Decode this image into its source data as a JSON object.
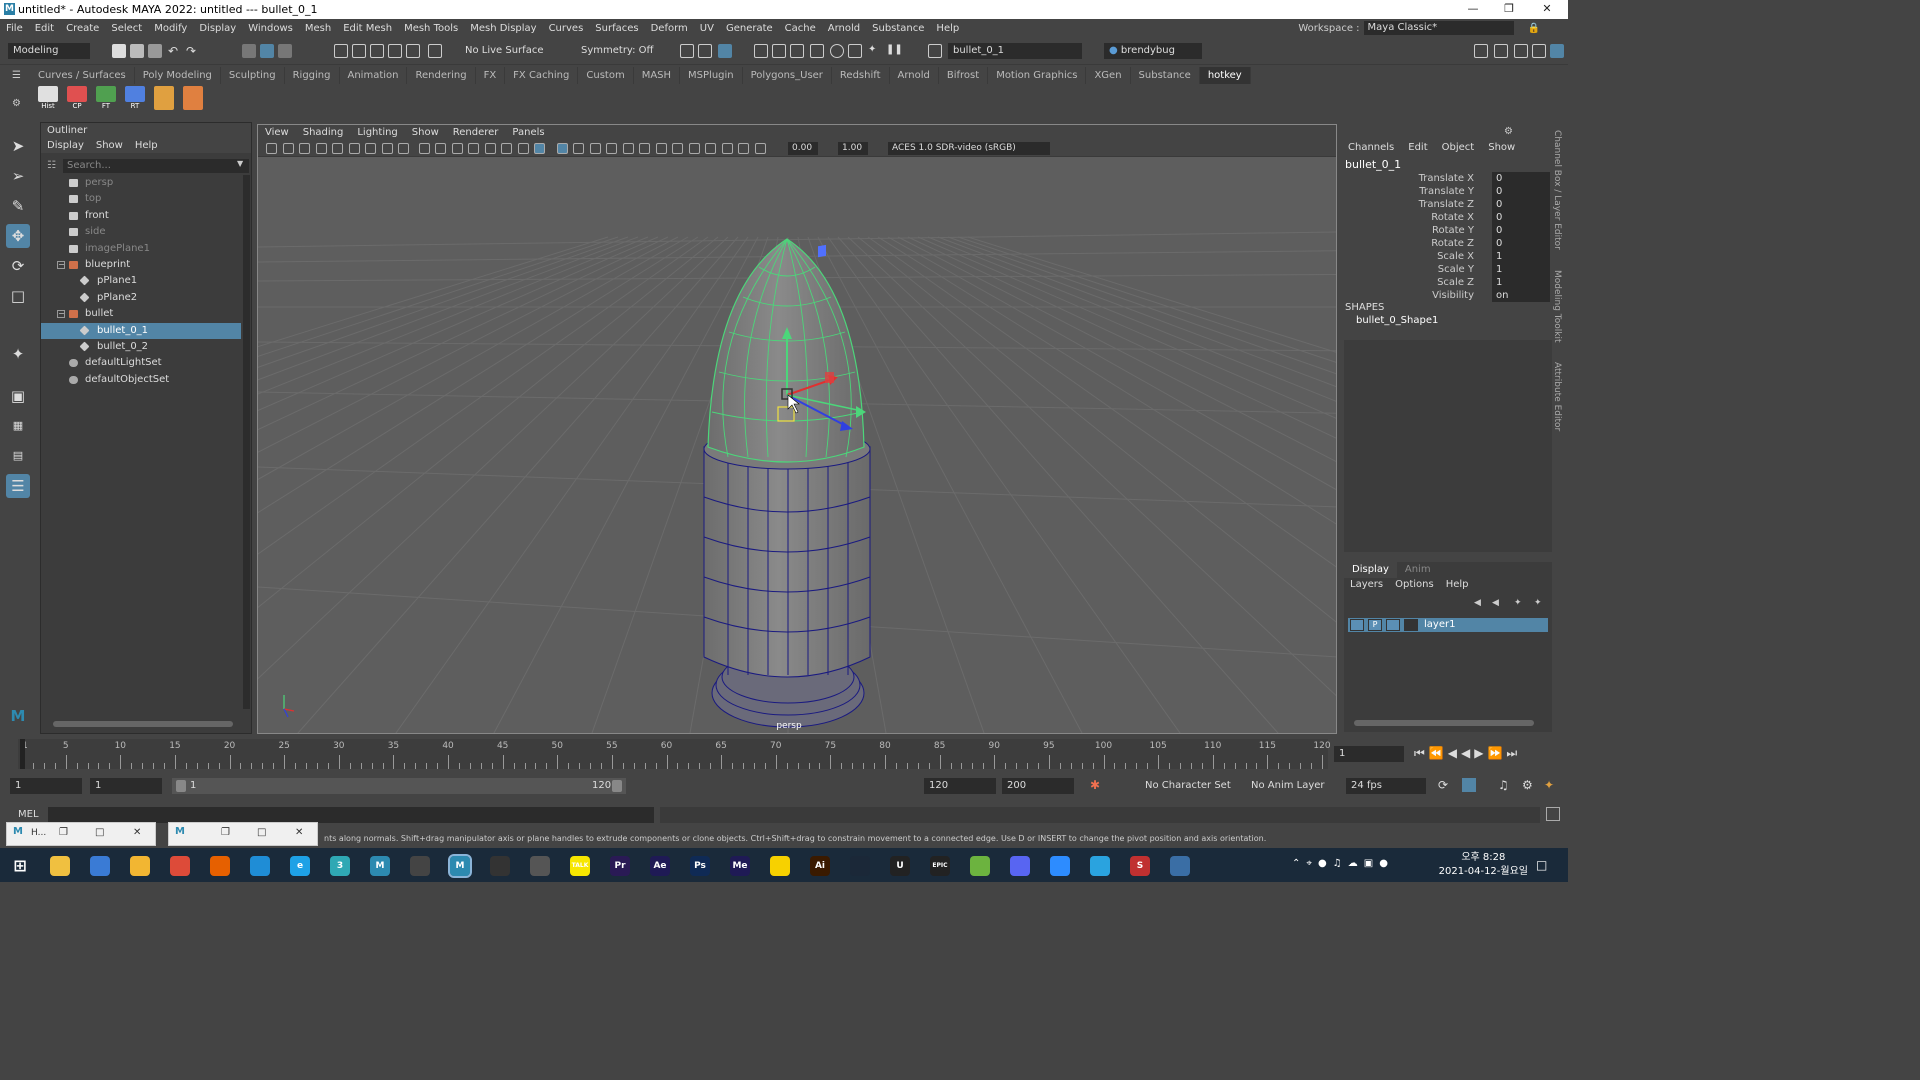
{
  "window": {
    "title": "untitled* - Autodesk MAYA 2022: untitled   ---   bullet_0_1",
    "logo": "M"
  },
  "menubar": [
    "File",
    "Edit",
    "Create",
    "Select",
    "Modify",
    "Display",
    "Windows",
    "Mesh",
    "Edit Mesh",
    "Mesh Tools",
    "Mesh Display",
    "Curves",
    "Surfaces",
    "Deform",
    "UV",
    "Generate",
    "Cache",
    "Arnold",
    "Substance",
    "Help"
  ],
  "workspace": {
    "label": "Workspace :",
    "value": "Maya Classic*"
  },
  "statusline": {
    "mode": "Modeling",
    "live_surface": "No Live Surface",
    "symmetry": "Symmetry: Off",
    "object_field": "bullet_0_1",
    "user": "brendybug"
  },
  "shelf_tabs": [
    "Curves / Surfaces",
    "Poly Modeling",
    "Sculpting",
    "Rigging",
    "Animation",
    "Rendering",
    "FX",
    "FX Caching",
    "Custom",
    "MASH",
    "MSPlugin",
    "Polygons_User",
    "Redshift",
    "Arnold",
    "Bifrost",
    "Motion Graphics",
    "XGen",
    "Substance",
    "hotkey"
  ],
  "shelf_active": "hotkey",
  "shelf_buttons": [
    {
      "label": "Hist",
      "color": "#e0e0e0"
    },
    {
      "label": "CP",
      "color": "#e05050"
    },
    {
      "label": "FT",
      "color": "#50a050"
    },
    {
      "label": "RT",
      "color": "#5080e0"
    }
  ],
  "outliner": {
    "title": "Outliner",
    "menu": [
      "Display",
      "Show",
      "Help"
    ],
    "search_placeholder": "Search...",
    "items": [
      {
        "label": "persp",
        "dim": true
      },
      {
        "label": "top",
        "dim": true
      },
      {
        "label": "front",
        "dim": false
      },
      {
        "label": "side",
        "dim": true
      },
      {
        "label": "imagePlane1",
        "dim": true
      },
      {
        "label": "blueprint",
        "dim": false
      },
      {
        "label": "pPlane1",
        "dim": false
      },
      {
        "label": "pPlane2",
        "dim": false
      },
      {
        "label": "bullet",
        "dim": false
      },
      {
        "label": "bullet_0_1",
        "dim": false,
        "selected": true
      },
      {
        "label": "bullet_0_2",
        "dim": false
      },
      {
        "label": "defaultLightSet",
        "dim": false
      },
      {
        "label": "defaultObjectSet",
        "dim": false
      }
    ]
  },
  "viewport": {
    "menu": [
      "View",
      "Shading",
      "Lighting",
      "Show",
      "Renderer",
      "Panels"
    ],
    "exposure": "0.00",
    "gamma": "1.00",
    "color_space": "ACES 1.0 SDR-video (sRGB)",
    "camera_label": "persp"
  },
  "channel_box": {
    "menu": [
      "Channels",
      "Edit",
      "Object",
      "Show"
    ],
    "object": "bullet_0_1",
    "channels": [
      {
        "label": "Translate X",
        "value": "0"
      },
      {
        "label": "Translate Y",
        "value": "0"
      },
      {
        "label": "Translate Z",
        "value": "0"
      },
      {
        "label": "Rotate X",
        "value": "0"
      },
      {
        "label": "Rotate Y",
        "value": "0"
      },
      {
        "label": "Rotate Z",
        "value": "0"
      },
      {
        "label": "Scale X",
        "value": "1"
      },
      {
        "label": "Scale Y",
        "value": "1"
      },
      {
        "label": "Scale Z",
        "value": "1"
      },
      {
        "label": "Visibility",
        "value": "on"
      }
    ],
    "shapes_header": "SHAPES",
    "shape": "bullet_0_Shape1",
    "side_tabs": [
      "Channel Box / Layer Editor",
      "Modeling Toolkit",
      "Attribute Editor"
    ]
  },
  "layers": {
    "tabs": [
      "Display",
      "Anim"
    ],
    "menu": [
      "Layers",
      "Options",
      "Help"
    ],
    "layer_name": "layer1",
    "layer_flag": "P"
  },
  "timeline": {
    "ticks": [
      1,
      5,
      10,
      15,
      20,
      25,
      30,
      35,
      40,
      45,
      50,
      55,
      60,
      65,
      70,
      75,
      80,
      85,
      90,
      95,
      100,
      105,
      110,
      115,
      120
    ],
    "current_frame": "1"
  },
  "range": {
    "start": "1",
    "playback_start": "1",
    "slider_start": "1",
    "slider_end": "120",
    "playback_end": "120",
    "end": "200",
    "character_set": "No Character Set",
    "anim_layer": "No Anim Layer",
    "fps": "24 fps"
  },
  "command_line": {
    "label": "MEL"
  },
  "help_line": "nts along normals. Shift+drag manipulator axis or plane handles to extrude components or clone objects. Ctrl+Shift+drag to constrain movement to a connected edge. Use D or INSERT to change the pivot position and axis orientation.",
  "minimized_windows": [
    {
      "label": "H..."
    },
    {
      "label": ""
    }
  ],
  "taskbar": {
    "apps": [
      {
        "name": "explorer",
        "color": "#f0c040",
        "glyph": ""
      },
      {
        "name": "calculator",
        "color": "#3a7bd5",
        "glyph": ""
      },
      {
        "name": "files",
        "color": "#f2b632",
        "glyph": ""
      },
      {
        "name": "chrome",
        "color": "#dd4b39",
        "glyph": ""
      },
      {
        "name": "firefox",
        "color": "#e66000",
        "glyph": ""
      },
      {
        "name": "edge",
        "color": "#1f8dd6",
        "glyph": ""
      },
      {
        "name": "ie",
        "color": "#1ea1e6",
        "glyph": "e"
      },
      {
        "name": "3",
        "color": "#2fa8b4",
        "glyph": "3"
      },
      {
        "name": "maya-a",
        "color": "#2d8ab0",
        "glyph": "M"
      },
      {
        "name": "davinci",
        "color": "#444",
        "glyph": ""
      },
      {
        "name": "maya-b",
        "color": "#2d8ab0",
        "glyph": "M"
      },
      {
        "name": "clock-app",
        "color": "#333",
        "glyph": ""
      },
      {
        "name": "gear-app",
        "color": "#555",
        "glyph": ""
      },
      {
        "name": "talk",
        "color": "#f7e600",
        "glyph": "TALK"
      },
      {
        "name": "premiere",
        "color": "#2a1a55",
        "glyph": "Pr"
      },
      {
        "name": "after-effects",
        "color": "#1f1a55",
        "glyph": "Ae"
      },
      {
        "name": "photoshop",
        "color": "#0f2a55",
        "glyph": "Ps"
      },
      {
        "name": "media-encoder",
        "color": "#1f1a55",
        "glyph": "Me"
      },
      {
        "name": "sticky",
        "color": "#f7d100",
        "glyph": ""
      },
      {
        "name": "illustrator",
        "color": "#3a1a00",
        "glyph": "Ai"
      },
      {
        "name": "steam",
        "color": "#1b2838",
        "glyph": ""
      },
      {
        "name": "unreal",
        "color": "#222",
        "glyph": "U"
      },
      {
        "name": "epic",
        "color": "#222",
        "glyph": "EPIC"
      },
      {
        "name": "xbox",
        "color": "#6cb33f",
        "glyph": ""
      },
      {
        "name": "discord",
        "color": "#5865f2",
        "glyph": ""
      },
      {
        "name": "zoom",
        "color": "#2d8cff",
        "glyph": ""
      },
      {
        "name": "telegram",
        "color": "#2aa3df",
        "glyph": ""
      },
      {
        "name": "substance",
        "color": "#c03030",
        "glyph": "S"
      },
      {
        "name": "app-last",
        "color": "#3a6ea5",
        "glyph": ""
      }
    ],
    "time": "오후 8:28",
    "date": "2021-04-12-월요일"
  }
}
